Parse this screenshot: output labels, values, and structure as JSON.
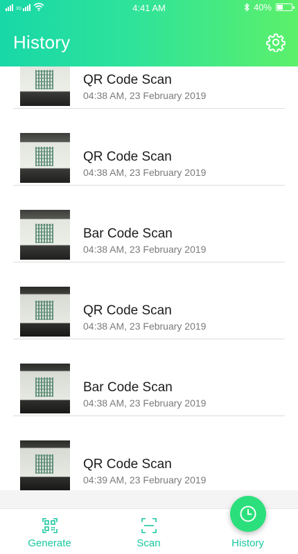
{
  "status_bar": {
    "time": "4:41 AM",
    "signal_tag": "3G",
    "battery": "40%",
    "battery_level": 0.4
  },
  "app_bar": {
    "title": "History",
    "settings_icon": "gear-icon"
  },
  "history": {
    "items": [
      {
        "title": "QR Code Scan",
        "date": "04:38 AM, 23 February 2019"
      },
      {
        "title": "QR Code Scan",
        "date": "04:38 AM, 23 February 2019"
      },
      {
        "title": "Bar Code Scan",
        "date": "04:38 AM, 23 February 2019"
      },
      {
        "title": "QR Code Scan",
        "date": "04:38 AM, 23 February 2019"
      },
      {
        "title": "Bar Code Scan",
        "date": "04:38 AM, 23 February 2019"
      },
      {
        "title": "QR Code Scan",
        "date": "04:39 AM, 23 February 2019"
      }
    ]
  },
  "bottom_nav": {
    "generate": "Generate",
    "scan": "Scan",
    "history": "History"
  },
  "colors": {
    "accent": "#19c7a0",
    "header_start": "#18d8a8",
    "header_end": "#5cf06a",
    "fab": "#2be07c"
  }
}
